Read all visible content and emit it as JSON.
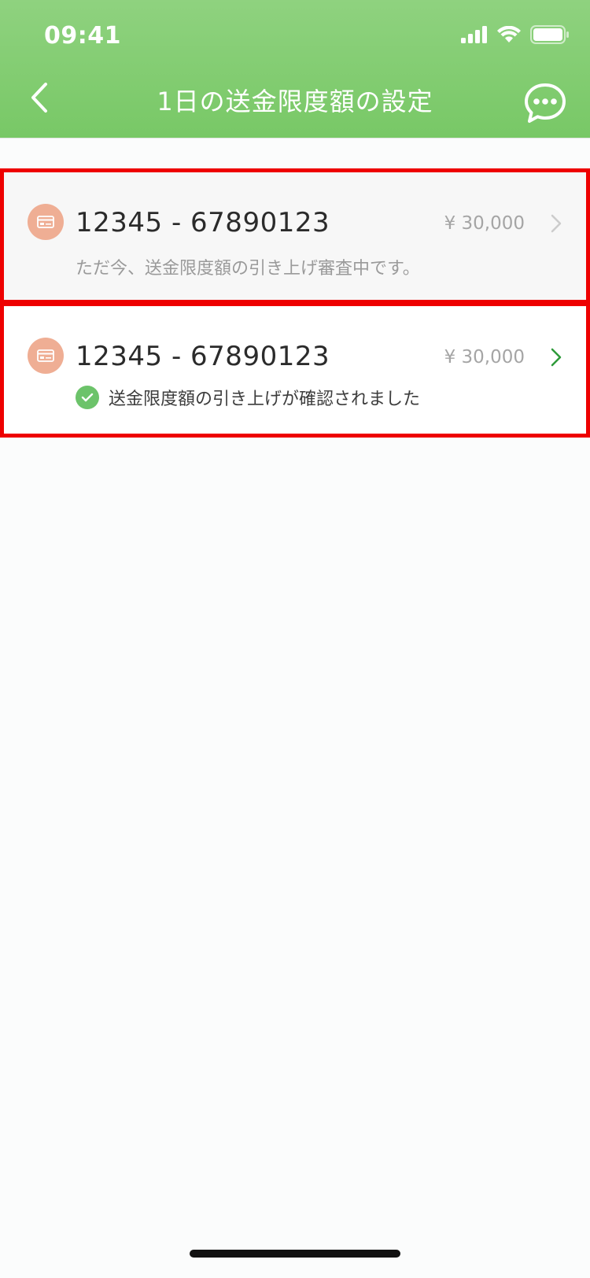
{
  "status_bar": {
    "time": "09:41"
  },
  "header": {
    "title": "1日の送金限度額の設定",
    "back_icon": "chevron-left-icon",
    "chat_icon": "chat-bubble-icon"
  },
  "accounts": [
    {
      "number": "12345 - 67890123",
      "amount": "¥ 30,000",
      "status": "ただ今、送金限度額の引き上げ審査中です。",
      "state": "pending"
    },
    {
      "number": "12345 - 67890123",
      "amount": "¥ 30,000",
      "status": "送金限度額の引き上げが確認されました",
      "state": "confirmed"
    }
  ],
  "colors": {
    "header_green": "#7fcb6d",
    "highlight_red": "#ee0000",
    "icon_salmon": "#efae94",
    "check_green": "#6cc36a",
    "chevron_active": "#2e9a3a",
    "chevron_inactive": "#cccccc"
  }
}
